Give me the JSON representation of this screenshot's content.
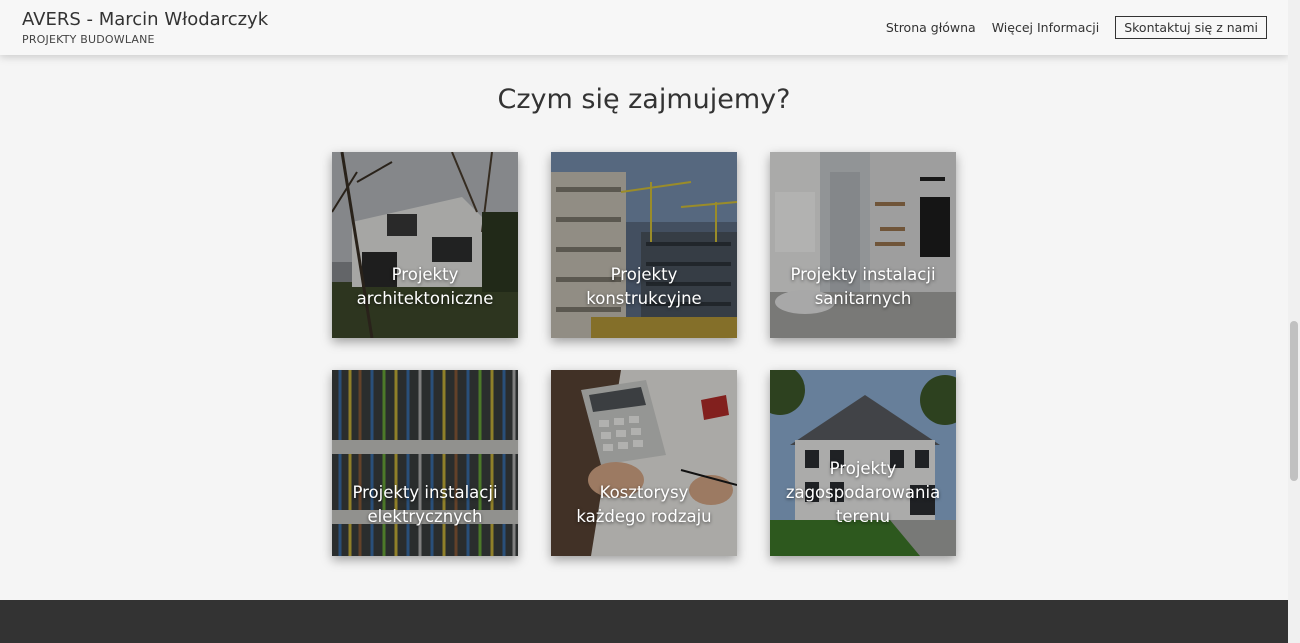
{
  "navbar": {
    "title": "AVERS - Marcin Włodarczyk",
    "subtitle": "PROJEKTY BUDOWLANE",
    "links": [
      "Strona główna",
      "Więcej Informacji"
    ],
    "contact_label": "Skontaktuj się z nami"
  },
  "section": {
    "title": "Czym się zajmujemy?"
  },
  "tiles": [
    {
      "lines": [
        "Projekty",
        "architektoniczne"
      ]
    },
    {
      "lines": [
        "Projekty",
        "konstrukcyjne"
      ]
    },
    {
      "lines": [
        "Projekty instalacji",
        "sanitarnych"
      ]
    },
    {
      "lines": [
        "Projekty instalacji",
        "elektrycznych"
      ]
    },
    {
      "lines": [
        "Kosztorysy",
        "każdego rodzaju"
      ]
    },
    {
      "lines": [
        "Projekty",
        "zagospodarowania",
        "terenu"
      ]
    }
  ]
}
